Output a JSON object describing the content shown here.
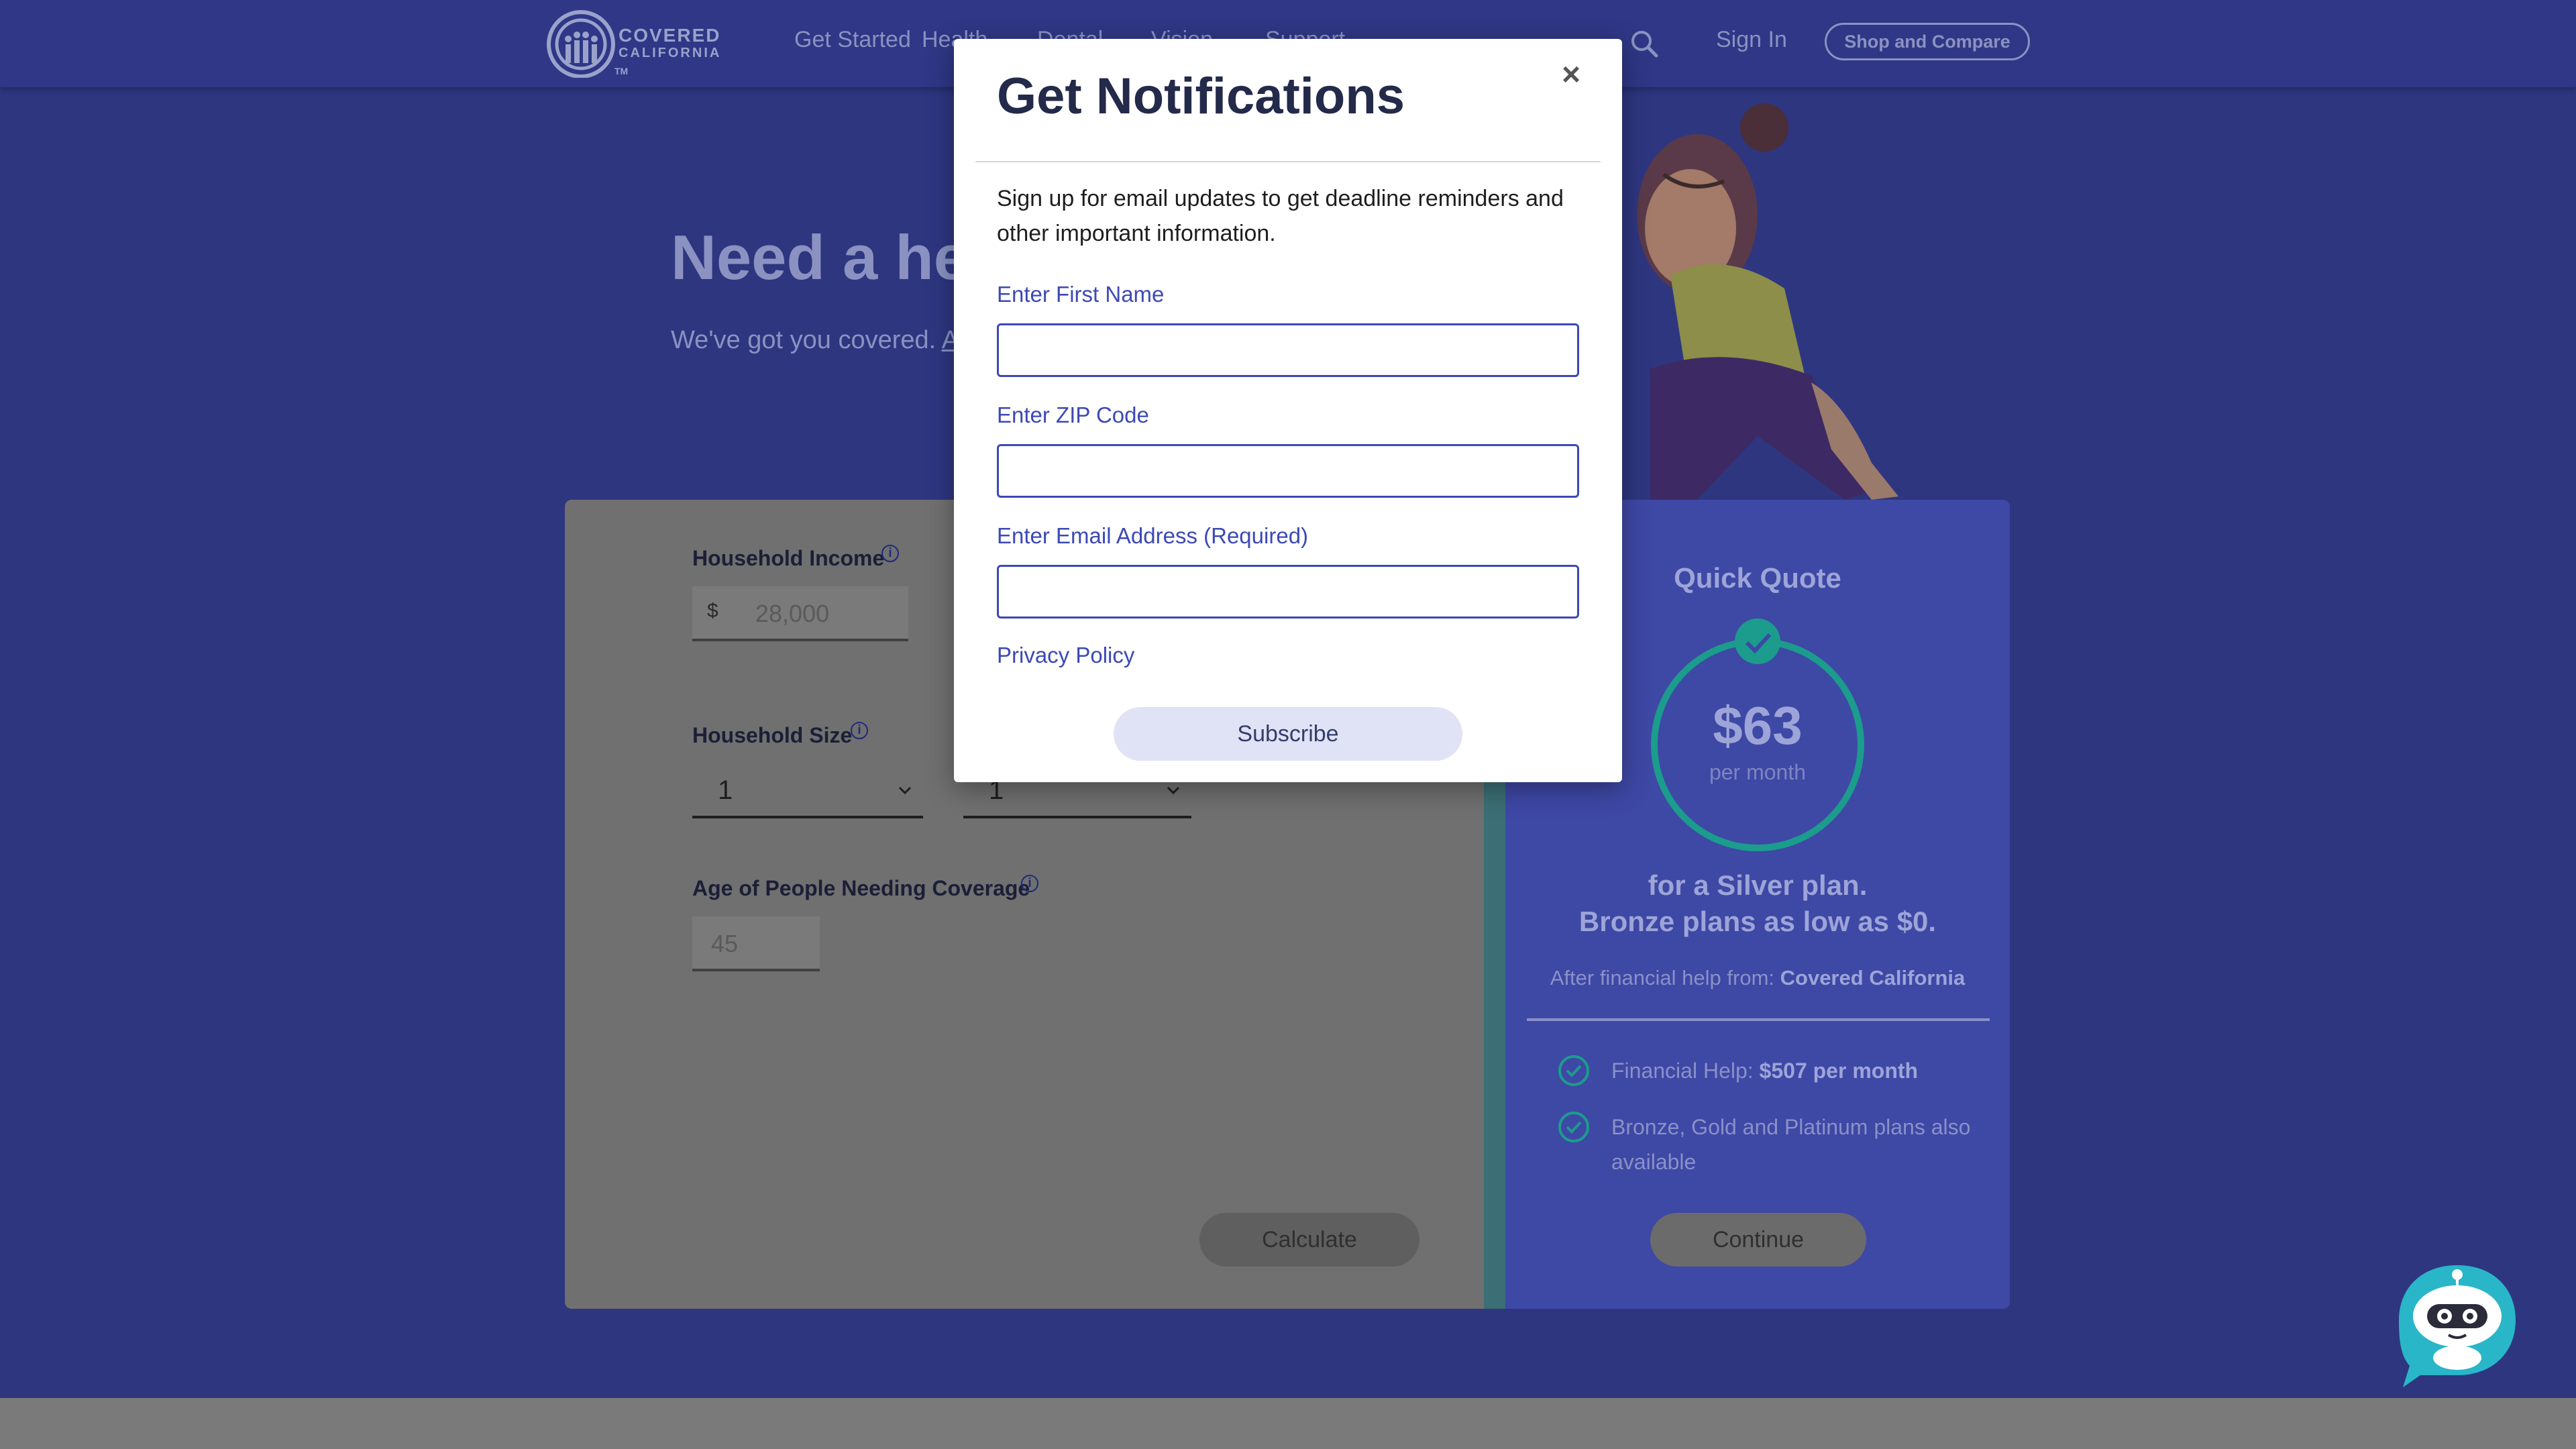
{
  "header": {
    "logo_line1": "COVERED",
    "logo_line2": "CALIFORNIA",
    "logo_tm": "TM",
    "nav": [
      "Get Started",
      "Health",
      "Dental",
      "Vision",
      "Support"
    ],
    "sign_in": "Sign In",
    "shop_button": "Shop and Compare"
  },
  "hero": {
    "title_visible": "Need a hea",
    "subtitle_visible": "We've got you covered.",
    "subtitle_link_visible": "Ap"
  },
  "calculator": {
    "income_label": "Household Income",
    "currency": "$",
    "income_placeholder": "28,000",
    "size_label": "Household Size",
    "size_value": "1",
    "second_select_value": "1",
    "age_label": "Age of People Needing Coverage",
    "age_placeholder": "45",
    "calculate_button": "Calculate"
  },
  "quote": {
    "title": "Quick Quote",
    "price": "$63",
    "per": "per month",
    "line1": "for a Silver plan.",
    "line2": "Bronze plans as low as $0.",
    "after_prefix": "After financial help from:",
    "after_source": "Covered California",
    "items": [
      {
        "prefix": "Financial Help:",
        "bold": "$507 per month"
      },
      {
        "prefix": "Bronze, Gold and Platinum plans also available",
        "bold": ""
      }
    ],
    "continue_button": "Continue"
  },
  "modal": {
    "title": "Get Notifications",
    "close": "×",
    "description": "Sign up for email updates to get deadline reminders and other important information.",
    "first_name_label": "Enter First Name",
    "first_name_value": "",
    "zip_label": "Enter ZIP Code",
    "zip_value": "",
    "email_label": "Enter Email Address (Required)",
    "email_value": "",
    "privacy_link": "Privacy Policy",
    "subscribe_button": "Subscribe"
  },
  "colors": {
    "brand_blue": "#2f3786",
    "modal_accent": "#3c49b5",
    "teal": "#1b9c8c"
  }
}
